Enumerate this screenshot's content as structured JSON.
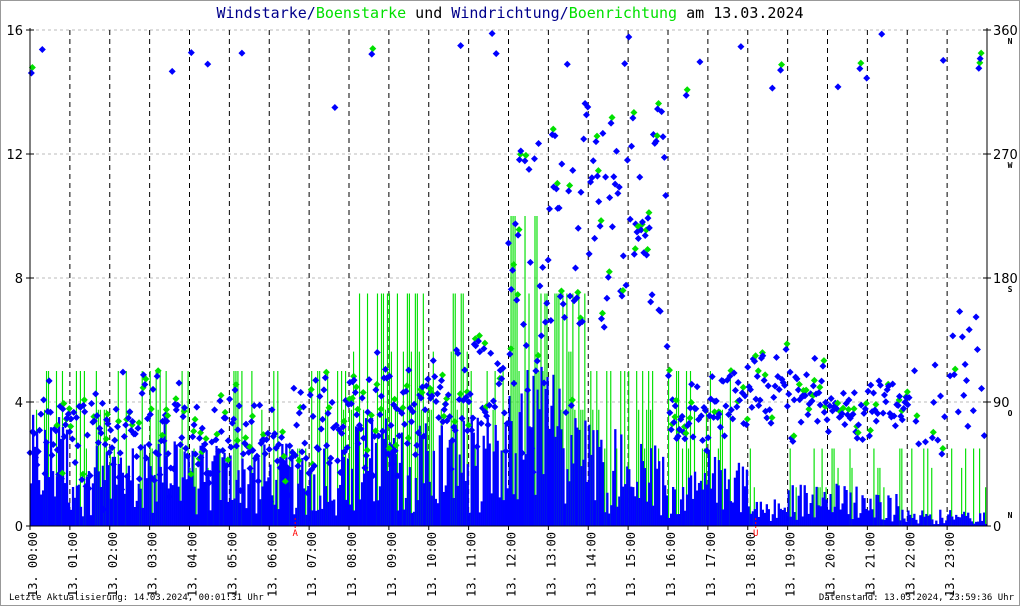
{
  "title": {
    "part1": "Windstarke/",
    "part2": "Boenstarke",
    "part3": " und ",
    "part4": "Windrichtung/",
    "part5": "Boenrichtung",
    "part6": " am 13.03.2024"
  },
  "colors": {
    "wind": "#0000ff",
    "gust": "#00e000",
    "wind_dir": "#0000ff",
    "gust_dir": "#00e000",
    "sun": "#ff0000"
  },
  "footer": {
    "left": "Letzte Aktualisierung: 14.03.2024, 00:01:31 Uhr",
    "right": "Datenstand: 13.03.2024, 23:59:36 Uhr"
  },
  "chart_data": {
    "type": "bar+scatter",
    "title": "Windstarke/Boenstarke und Windrichtung/Boenrichtung am 13.03.2024",
    "x_range_hours": [
      0,
      24
    ],
    "x_tick_labels": [
      "13. 00:00",
      "13. 01:00",
      "13. 02:00",
      "13. 03:00",
      "13. 04:00",
      "13. 05:00",
      "13. 06:00",
      "13. 07:00",
      "13. 08:00",
      "13. 09:00",
      "13. 10:00",
      "13. 11:00",
      "13. 12:00",
      "13. 13:00",
      "13. 14:00",
      "13. 15:00",
      "13. 16:00",
      "13. 17:00",
      "13. 18:00",
      "13. 19:00",
      "13. 20:00",
      "13. 21:00",
      "13. 22:00",
      "13. 23:00"
    ],
    "y_left": {
      "range": [
        0,
        16
      ],
      "ticks": [
        "0",
        "4",
        "8",
        "12",
        "16"
      ]
    },
    "y_right": {
      "range": [
        0,
        360
      ],
      "ticks": [
        "0",
        "90",
        "180",
        "270",
        "360"
      ],
      "compass": [
        "N",
        "O",
        "S",
        "W",
        "N"
      ]
    },
    "grid": true,
    "markers": [
      {
        "label": "A",
        "hour": 6.65
      },
      {
        "label": "U",
        "hour": 18.2
      }
    ],
    "hourly": {
      "wind_mean": [
        2,
        1.5,
        1.5,
        2,
        1.5,
        1.5,
        1.5,
        1.5,
        2,
        2,
        2,
        2,
        3,
        3,
        2,
        1.5,
        1,
        1.5,
        0.5,
        0.8,
        0.8,
        0.6,
        0.3,
        0.3
      ],
      "gust_max": [
        5,
        5,
        5,
        5,
        2.5,
        5,
        5,
        5,
        7.5,
        7.5,
        7.5,
        5,
        10,
        7.5,
        5,
        5,
        5,
        5,
        2.5,
        2.5,
        2.5,
        2.5,
        2.5,
        2.5
      ],
      "gust_share": [
        0.4,
        0.5,
        0.4,
        0.5,
        0.4,
        0.4,
        0.4,
        0.4,
        0.5,
        0.6,
        0.6,
        0.5,
        0.7,
        0.7,
        0.5,
        0.5,
        0.4,
        0.4,
        0.2,
        0.3,
        0.3,
        0.3,
        0.2,
        0.2
      ],
      "direction_mean": [
        70,
        60,
        70,
        65,
        55,
        65,
        60,
        70,
        75,
        80,
        85,
        90,
        160,
        210,
        230,
        220,
        80,
        90,
        100,
        90,
        80,
        90,
        85,
        110
      ],
      "direction_spread": [
        35,
        35,
        35,
        35,
        30,
        30,
        35,
        35,
        40,
        40,
        40,
        40,
        100,
        100,
        90,
        80,
        25,
        25,
        25,
        25,
        20,
        20,
        25,
        40
      ]
    }
  }
}
